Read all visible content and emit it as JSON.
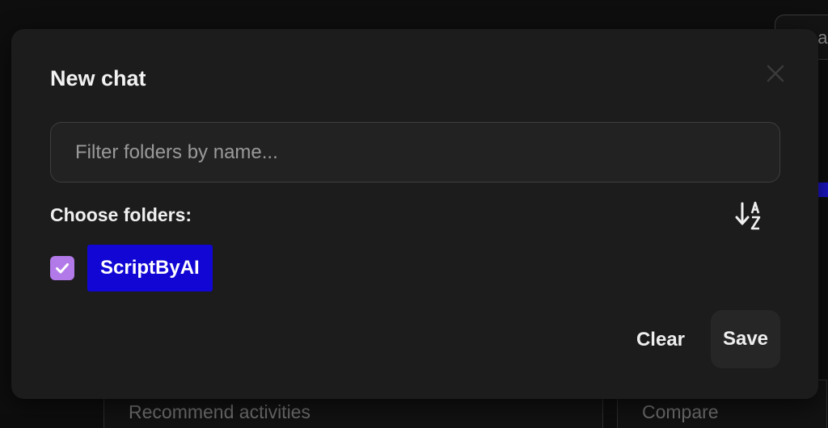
{
  "background": {
    "search_fragment": "ea",
    "card_left_text": "Recommend activities",
    "card_right_text": "Compare"
  },
  "modal": {
    "title": "New chat",
    "filter": {
      "placeholder": "Filter folders by name...",
      "value": ""
    },
    "choose_label": "Choose folders:",
    "sort_icon": "sort-alpha-down-icon",
    "close_icon": "close-icon",
    "folders": [
      {
        "name": "ScriptByAI",
        "checked": true
      }
    ],
    "actions": {
      "clear_label": "Clear",
      "save_label": "Save"
    }
  },
  "colors": {
    "modal_bg": "#1c1c1c",
    "checkbox": "#b27ae8",
    "folder_chip": "#1106d4"
  }
}
